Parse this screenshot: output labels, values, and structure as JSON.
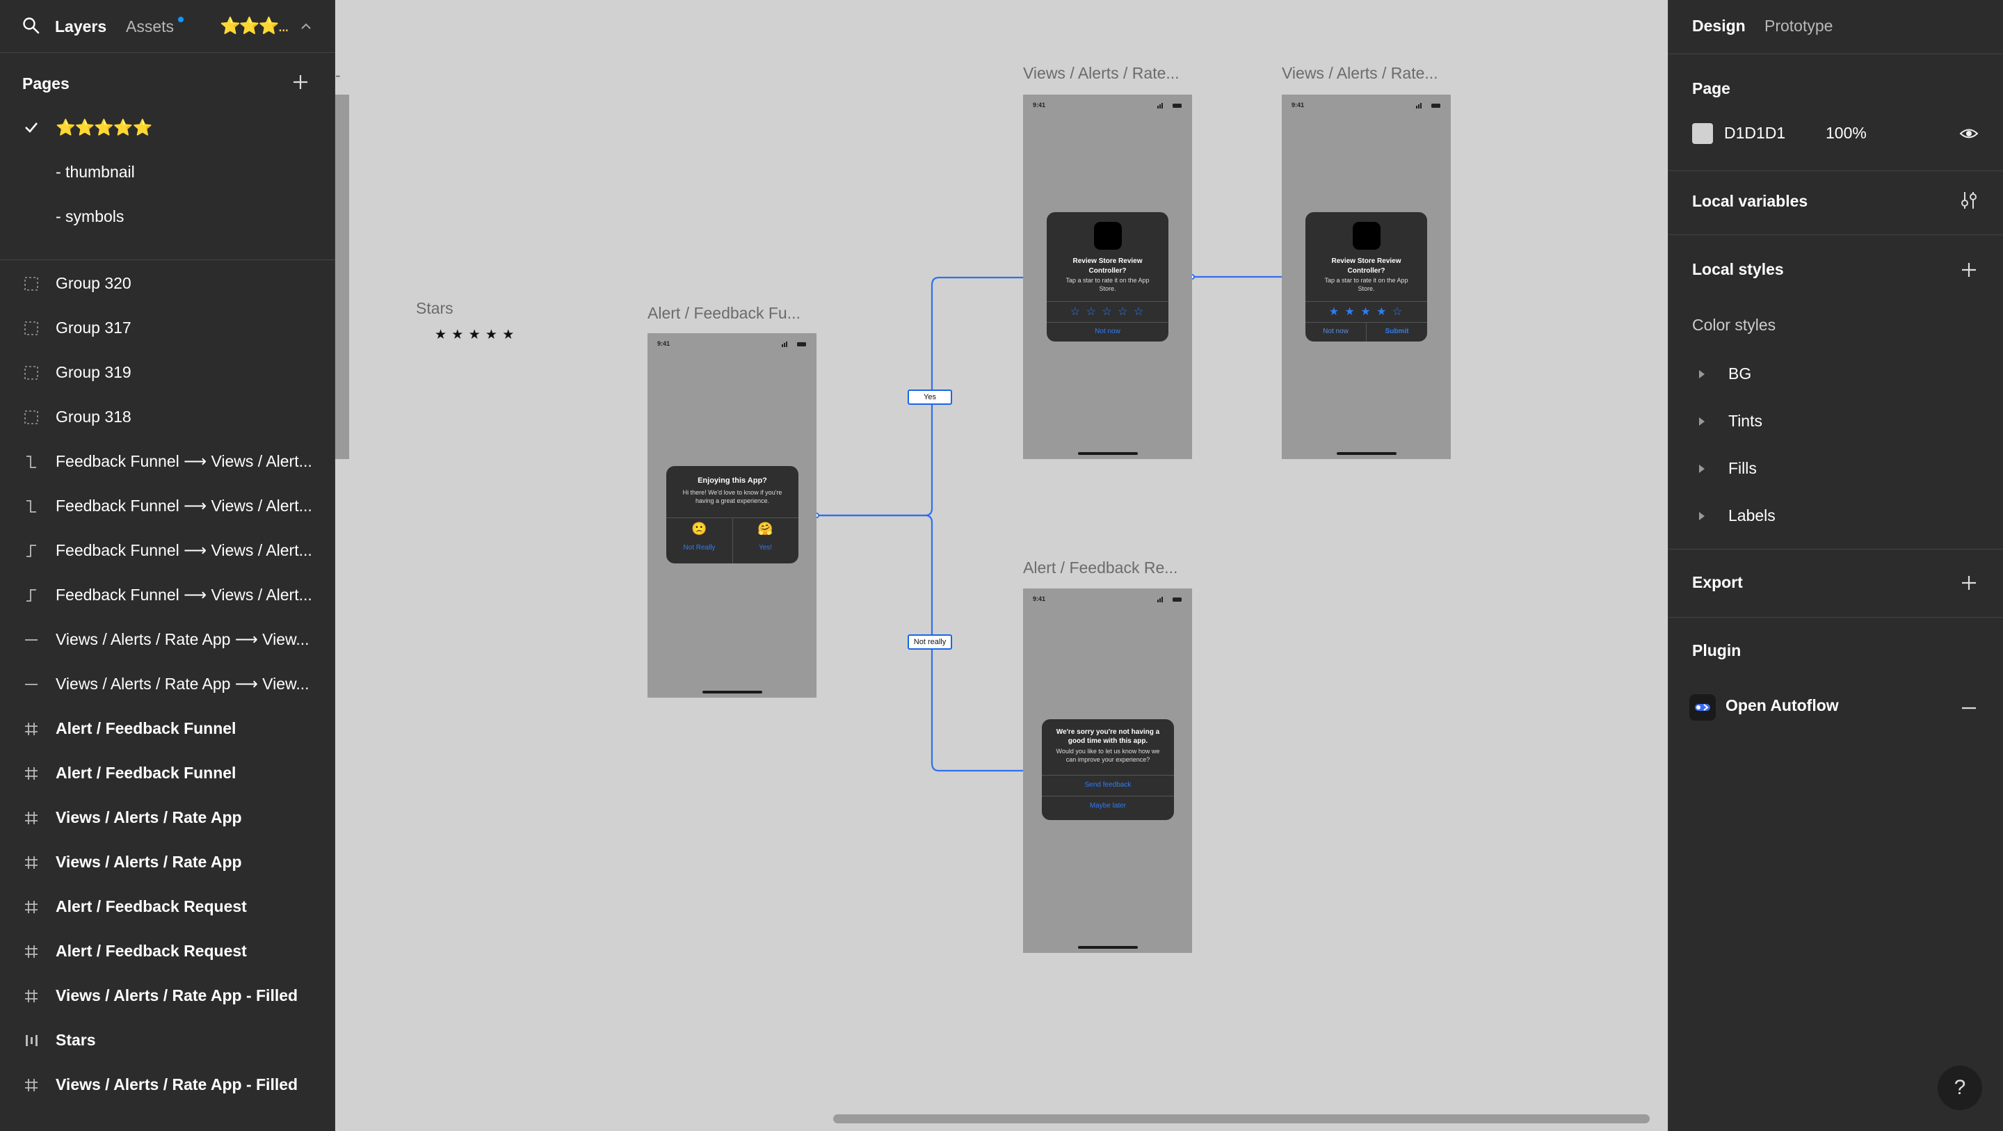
{
  "topbar": {
    "layers": "Layers",
    "assets": "Assets",
    "current_page": "⭐️⭐️⭐️..."
  },
  "pages": {
    "title": "Pages",
    "items": [
      {
        "label": "⭐️⭐️⭐️⭐️⭐️",
        "selected": true
      },
      {
        "label": "- thumbnail",
        "selected": false
      },
      {
        "label": "- symbols",
        "selected": false
      }
    ]
  },
  "layers": [
    {
      "name": "Group 320",
      "icon": "group-icon",
      "bold": false
    },
    {
      "name": "Group 317",
      "icon": "group-icon",
      "bold": false
    },
    {
      "name": "Group 319",
      "icon": "group-icon",
      "bold": false
    },
    {
      "name": "Group 318",
      "icon": "group-icon",
      "bold": false
    },
    {
      "name": "Feedback Funnel ⟶ Views / Alert...",
      "icon": "connector-elbow-down-icon",
      "bold": false
    },
    {
      "name": "Feedback Funnel ⟶ Views / Alert...",
      "icon": "connector-elbow-down-icon",
      "bold": false
    },
    {
      "name": "Feedback Funnel ⟶ Views / Alert...",
      "icon": "connector-elbow-up-icon",
      "bold": false
    },
    {
      "name": "Feedback Funnel ⟶ Views / Alert...",
      "icon": "connector-elbow-up-icon",
      "bold": false
    },
    {
      "name": "Views / Alerts / Rate App ⟶ View...",
      "icon": "connector-straight-icon",
      "bold": false
    },
    {
      "name": "Views / Alerts / Rate App ⟶ View...",
      "icon": "connector-straight-icon",
      "bold": false
    },
    {
      "name": "Alert / Feedback Funnel",
      "icon": "frame-icon",
      "bold": true
    },
    {
      "name": "Alert / Feedback Funnel",
      "icon": "frame-icon",
      "bold": true
    },
    {
      "name": "Views / Alerts / Rate App",
      "icon": "frame-icon",
      "bold": true
    },
    {
      "name": "Views / Alerts / Rate App",
      "icon": "frame-icon",
      "bold": true
    },
    {
      "name": "Alert / Feedback Request",
      "icon": "frame-icon",
      "bold": true
    },
    {
      "name": "Alert / Feedback Request",
      "icon": "frame-icon",
      "bold": true
    },
    {
      "name": "Views / Alerts / Rate App - Filled",
      "icon": "frame-icon",
      "bold": true
    },
    {
      "name": "Stars",
      "icon": "auto-layout-icon",
      "bold": true
    },
    {
      "name": "Views / Alerts / Rate App - Filled",
      "icon": "frame-icon",
      "bold": true
    }
  ],
  "canvas": {
    "stars_label": "Stars",
    "stars_glyphs": "★ ★ ★ ★ ★",
    "funnel": {
      "label": "Alert / Feedback Fu...",
      "time": "9:41",
      "title": "Enjoying this App?",
      "subtitle": "Hi there! We'd love to know if you're having a great experience.",
      "left_emoji": "🙁",
      "right_emoji": "🤗",
      "left_action": "Not Really",
      "right_action": "Yes!"
    },
    "rate_empty": {
      "label": "Views / Alerts / Rate...",
      "time": "9:41",
      "title": "Review Store Review Controller?",
      "subtitle": "Tap a star to rate it on the App Store.",
      "stars": "☆ ☆ ☆ ☆ ☆",
      "action": "Not now"
    },
    "rate_filled": {
      "label": "Views / Alerts / Rate...",
      "time": "9:41",
      "title": "Review Store Review Controller?",
      "subtitle": "Tap a star to rate it on the App Store.",
      "stars": "★ ★ ★ ★ ☆",
      "left_action": "Not now",
      "right_action": "Submit"
    },
    "request": {
      "label": "Alert / Feedback Re...",
      "time": "9:41",
      "title": "We're sorry you're not having a good time with this app.",
      "subtitle": "Would you like to let us know how we can improve your experience?",
      "primary": "Send feedback",
      "secondary": "Maybe later"
    },
    "yes_tag": "Yes",
    "no_tag": "Not really"
  },
  "right": {
    "tabs": {
      "design": "Design",
      "prototype": "Prototype"
    },
    "page": {
      "title": "Page",
      "color": "D1D1D1",
      "opacity": "100%"
    },
    "local_variables": "Local variables",
    "local_styles": "Local styles",
    "color_styles": {
      "title": "Color styles",
      "groups": [
        "BG",
        "Tints",
        "Fills",
        "Labels"
      ]
    },
    "export": "Export",
    "plugin": {
      "title": "Plugin",
      "name": "Open Autoflow"
    },
    "help": "?"
  },
  "colors": {
    "canvas": "#D1D1D1",
    "panel": "#2C2C2C",
    "accent": "#1A66E8",
    "star": "#FFC933"
  }
}
